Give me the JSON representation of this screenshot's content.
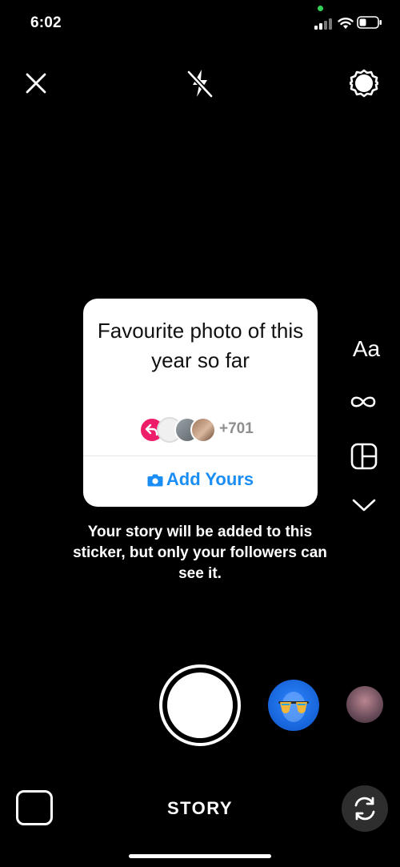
{
  "status_bar": {
    "time": "6:02",
    "privacy_dot_color": "#31d158"
  },
  "top_bar": {
    "close_icon": "close-icon",
    "flash_icon": "flash-off-icon",
    "settings_icon": "settings-gear-icon"
  },
  "sticker": {
    "title": "Favourite photo of this year so far",
    "participants_count": "+701",
    "action_label": "Add Yours",
    "action_color": "#1a8ef5",
    "badge_color": "#ee1d6a"
  },
  "tools": {
    "text_label": "Aa",
    "boomerang_icon": "infinity-icon",
    "layout_icon": "layout-icon",
    "more_icon": "chevron-down-icon"
  },
  "info_text": "Your story will be added to this sticker, but only your followers can see it.",
  "bottom": {
    "mode_label": "STORY",
    "gallery_icon": "gallery-icon",
    "flip_icon": "flip-camera-icon"
  }
}
